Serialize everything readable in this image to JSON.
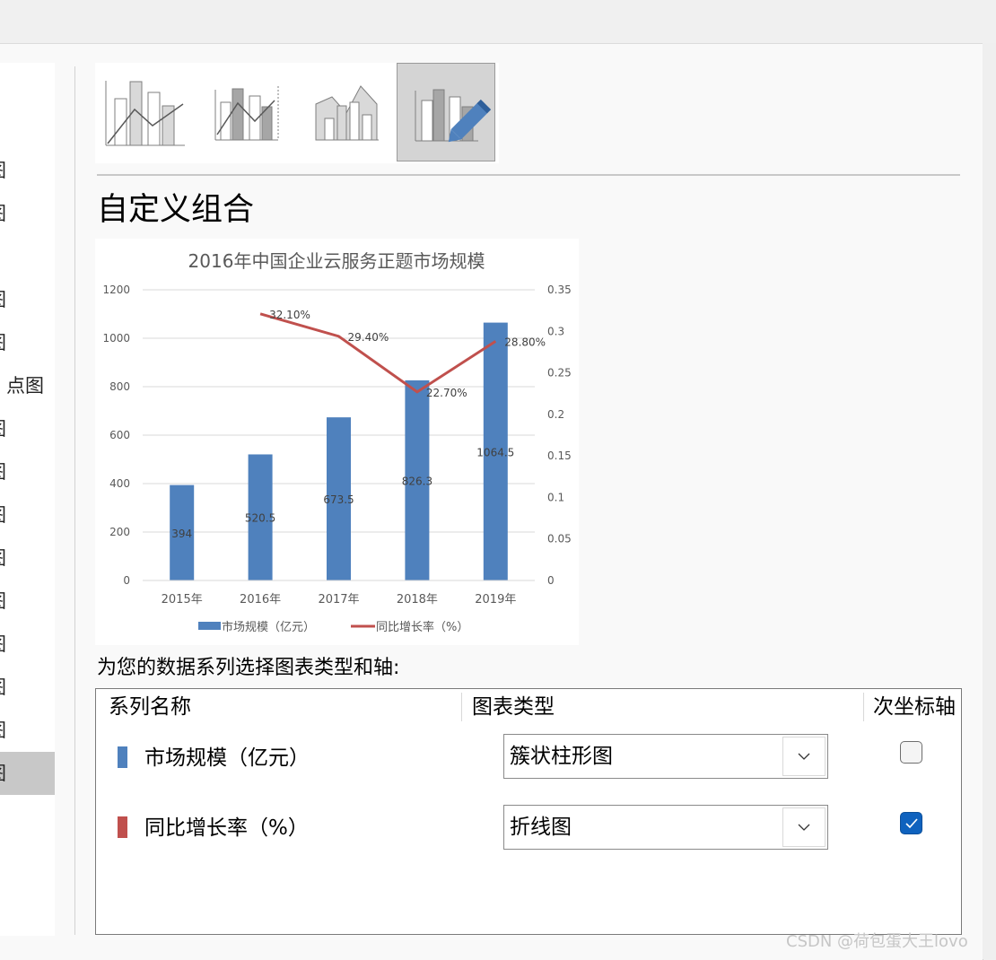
{
  "sidebar": {
    "items": [
      {
        "label": "图"
      },
      {
        "label": "图"
      },
      {
        "label": "图"
      },
      {
        "label": "图"
      },
      {
        "label": "点图"
      },
      {
        "label": "图"
      },
      {
        "label": "图"
      },
      {
        "label": "图"
      },
      {
        "label": "图"
      },
      {
        "label": "图"
      },
      {
        "label": "图"
      },
      {
        "label": "图"
      },
      {
        "label": "图"
      },
      {
        "label": "图"
      }
    ],
    "selected_index": 13
  },
  "thumbnails": [
    {
      "name": "clustered-column-line-icon",
      "selected": false
    },
    {
      "name": "clustered-column-line-secondary-axis-icon",
      "selected": false
    },
    {
      "name": "stacked-area-column-icon",
      "selected": false
    },
    {
      "name": "custom-combination-icon",
      "selected": true
    }
  ],
  "section_title": "自定义组合",
  "chart_data": {
    "type": "bar",
    "title": "2016年中国企业云服务正题市场规模",
    "categories": [
      "2015年",
      "2016年",
      "2017年",
      "2018年",
      "2019年"
    ],
    "y_ticks": [
      "0",
      "200",
      "400",
      "600",
      "800",
      "1000",
      "1200"
    ],
    "y2_ticks": [
      "0",
      "0.05",
      "0.1",
      "0.15",
      "0.2",
      "0.25",
      "0.3",
      "0.35"
    ],
    "ylim": [
      0,
      1200
    ],
    "y2lim": [
      0,
      0.35
    ],
    "grid": true,
    "legend_position": "bottom",
    "series": [
      {
        "name": "市场规模（亿元）",
        "type": "bar",
        "axis": "primary",
        "color": "#4f81bd",
        "values": [
          394,
          520.5,
          673.5,
          826.3,
          1064.5
        ],
        "labels": [
          "394",
          "520.5",
          "673.5",
          "826.3",
          "1064.5"
        ]
      },
      {
        "name": "同比增长率（%）",
        "type": "line",
        "axis": "secondary",
        "color": "#c0504d",
        "values": [
          null,
          0.321,
          0.294,
          0.227,
          0.288
        ],
        "labels": [
          "",
          "32.10%",
          "29.40%",
          "22.70%",
          "28.80%"
        ]
      }
    ]
  },
  "prompt": "为您的数据系列选择图表类型和轴:",
  "table": {
    "headers": {
      "series": "系列名称",
      "chart_type": "图表类型",
      "secondary_axis": "次坐标轴"
    },
    "rows": [
      {
        "name": "市场规模（亿元）",
        "color": "#4f81bd",
        "chart_type": "簇状柱形图",
        "secondary": false
      },
      {
        "name": "同比增长率（%）",
        "color": "#c0504d",
        "chart_type": "折线图",
        "secondary": true
      }
    ]
  },
  "watermark": "CSDN @荷包蛋大王lovo",
  "colors": {
    "accent": "#0f62be",
    "bar": "#4f81bd",
    "line": "#c0504d"
  }
}
